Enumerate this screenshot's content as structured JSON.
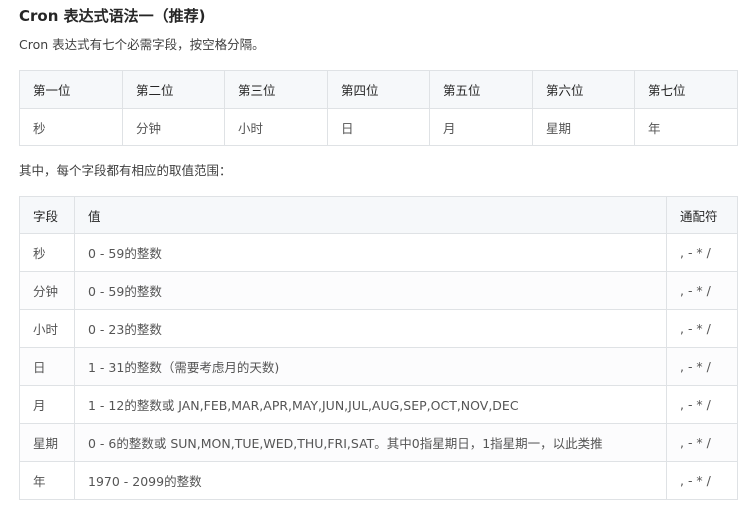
{
  "heading": "Cron 表达式语法一（推荐)",
  "intro": "Cron 表达式有七个必需字段，按空格分隔。",
  "positions_table": {
    "headers": [
      "第一位",
      "第二位",
      "第三位",
      "第四位",
      "第五位",
      "第六位",
      "第七位"
    ],
    "row": [
      "秒",
      "分钟",
      "小时",
      "日",
      "月",
      "星期",
      "年"
    ]
  },
  "range_intro": "其中，每个字段都有相应的取值范围：",
  "fields_table": {
    "headers": {
      "field": "字段",
      "value": "值",
      "wildcard": "通配符"
    },
    "rows": [
      {
        "field": "秒",
        "value": "0 - 59的整数",
        "wildcard": ", - * /"
      },
      {
        "field": "分钟",
        "value": "0 - 59的整数",
        "wildcard": ", - * /"
      },
      {
        "field": "小时",
        "value": "0 - 23的整数",
        "wildcard": ", - * /"
      },
      {
        "field": "日",
        "value": "1 - 31的整数（需要考虑月的天数)",
        "wildcard": ", - * /"
      },
      {
        "field": "月",
        "value": "1 - 12的整数或 JAN,FEB,MAR,APR,MAY,JUN,JUL,AUG,SEP,OCT,NOV,DEC",
        "wildcard": ", - * /"
      },
      {
        "field": "星期",
        "value": "0 - 6的整数或 SUN,MON,TUE,WED,THU,FRI,SAT。其中0指星期日，1指星期一，以此类推",
        "wildcard": ", - * /"
      },
      {
        "field": "年",
        "value": "1970 - 2099的整数",
        "wildcard": ", - * /"
      }
    ]
  }
}
